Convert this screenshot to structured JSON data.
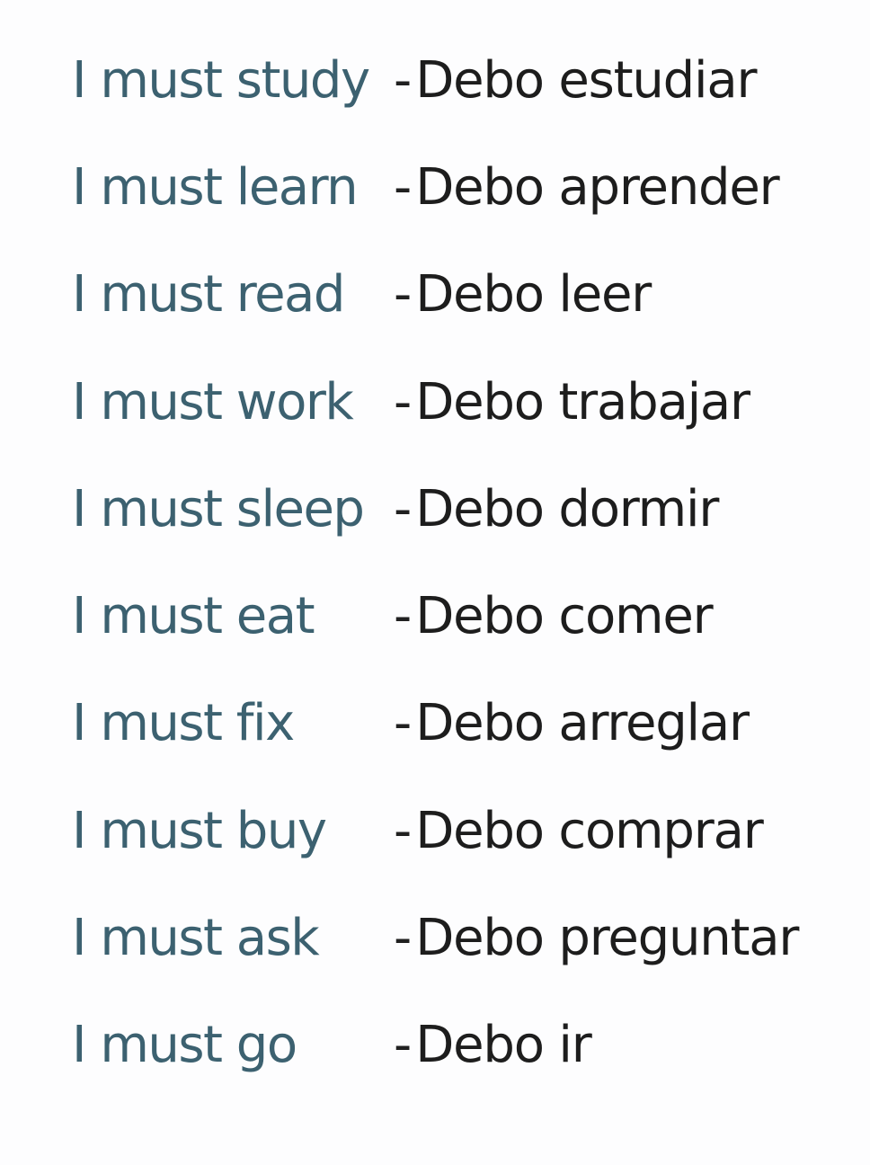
{
  "phrases": [
    {
      "english": "I must study",
      "separator": "-",
      "spanish": "Debo estudiar"
    },
    {
      "english": "I must learn",
      "separator": "-",
      "spanish": "Debo aprender"
    },
    {
      "english": "I must read",
      "separator": "-",
      "spanish": "Debo leer"
    },
    {
      "english": "I must work",
      "separator": "-",
      "spanish": "Debo trabajar"
    },
    {
      "english": "I must sleep",
      "separator": "-",
      "spanish": "Debo dormir"
    },
    {
      "english": "I must eat",
      "separator": "-",
      "spanish": "Debo comer"
    },
    {
      "english": "I must fix",
      "separator": "-",
      "spanish": "Debo arreglar"
    },
    {
      "english": "I must buy",
      "separator": "-",
      "spanish": "Debo comprar"
    },
    {
      "english": "I must ask",
      "separator": "-",
      "spanish": "Debo preguntar"
    },
    {
      "english": "I must go",
      "separator": "-",
      "spanish": "Debo ir"
    }
  ],
  "colors": {
    "english_text": "#3c6170",
    "spanish_text": "#1d1d1d",
    "background": "#fdfdfe"
  }
}
